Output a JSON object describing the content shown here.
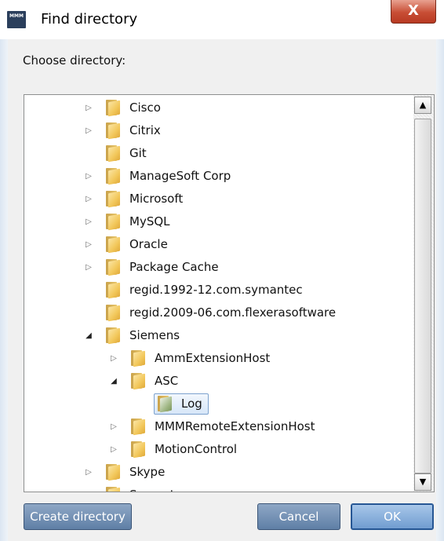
{
  "window": {
    "title": "Find directory",
    "icon_text": "MMM",
    "close_glyph": "X"
  },
  "dialog": {
    "choose_label": "Choose directory:"
  },
  "tree": {
    "items": [
      {
        "label": "Cisco",
        "depth": 0,
        "expander": "collapsed"
      },
      {
        "label": "Citrix",
        "depth": 0,
        "expander": "collapsed"
      },
      {
        "label": "Git",
        "depth": 0,
        "expander": "none"
      },
      {
        "label": "ManageSoft Corp",
        "depth": 0,
        "expander": "collapsed"
      },
      {
        "label": "Microsoft",
        "depth": 0,
        "expander": "collapsed"
      },
      {
        "label": "MySQL",
        "depth": 0,
        "expander": "collapsed"
      },
      {
        "label": "Oracle",
        "depth": 0,
        "expander": "collapsed"
      },
      {
        "label": "Package Cache",
        "depth": 0,
        "expander": "collapsed"
      },
      {
        "label": "regid.1992-12.com.symantec",
        "depth": 0,
        "expander": "none"
      },
      {
        "label": "regid.2009-06.com.flexerasoftware",
        "depth": 0,
        "expander": "none"
      },
      {
        "label": "Siemens",
        "depth": 0,
        "expander": "expanded"
      },
      {
        "label": "AmmExtensionHost",
        "depth": 1,
        "expander": "collapsed"
      },
      {
        "label": "ASC",
        "depth": 1,
        "expander": "expanded"
      },
      {
        "label": "Log",
        "depth": 2,
        "expander": "none",
        "selected": true
      },
      {
        "label": "MMMRemoteExtensionHost",
        "depth": 1,
        "expander": "collapsed"
      },
      {
        "label": "MotionControl",
        "depth": 1,
        "expander": "collapsed"
      },
      {
        "label": "Skype",
        "depth": 0,
        "expander": "collapsed"
      },
      {
        "label": "Symantec",
        "depth": 0,
        "expander": "collapsed"
      }
    ]
  },
  "scrollbar": {
    "up_glyph": "▲",
    "down_glyph": "▼"
  },
  "buttons": {
    "create": "Create directory",
    "cancel": "Cancel",
    "ok": "OK"
  }
}
